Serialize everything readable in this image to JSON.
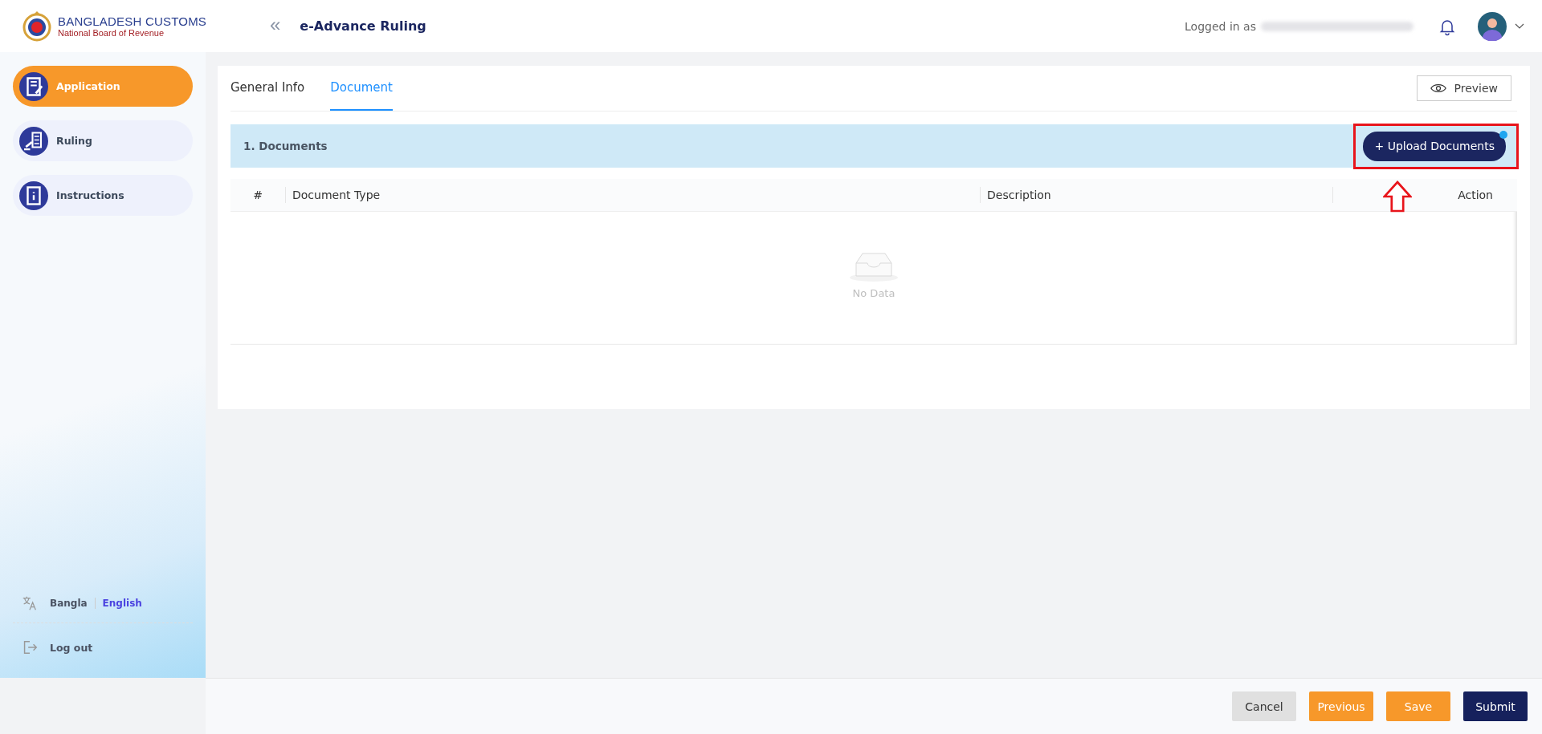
{
  "header": {
    "logo_title": "BANGLADESH CUSTOMS",
    "logo_subtitle": "National Board of Revenue",
    "collapse_glyph": "«",
    "page_title": "e-Advance Ruling",
    "logged_in_label": "Logged in as"
  },
  "sidebar": {
    "items": [
      {
        "label": "Application",
        "selected": true,
        "kind": "application"
      },
      {
        "label": "Ruling",
        "selected": false,
        "kind": "ruling"
      },
      {
        "label": "Instructions",
        "selected": false,
        "kind": "instructions"
      }
    ],
    "languages": [
      {
        "label": "Bangla",
        "selected": false
      },
      {
        "label": "English",
        "selected": true
      }
    ],
    "logout": "Log out"
  },
  "tabs": [
    {
      "label": "General Info",
      "selected": false
    },
    {
      "label": "Document",
      "selected": true
    }
  ],
  "preview_button": "Preview",
  "section": {
    "title": "1. Documents",
    "upload_button": "+ Upload Documents"
  },
  "table": {
    "columns": [
      "#",
      "Document Type",
      "Description",
      "Action"
    ],
    "empty_text": "No Data"
  },
  "footer_buttons": [
    {
      "label": "Cancel",
      "kind": "cancel"
    },
    {
      "label": "Previous",
      "kind": "orange"
    },
    {
      "label": "Save",
      "kind": "orange"
    },
    {
      "label": "Submit",
      "kind": "primary"
    }
  ]
}
